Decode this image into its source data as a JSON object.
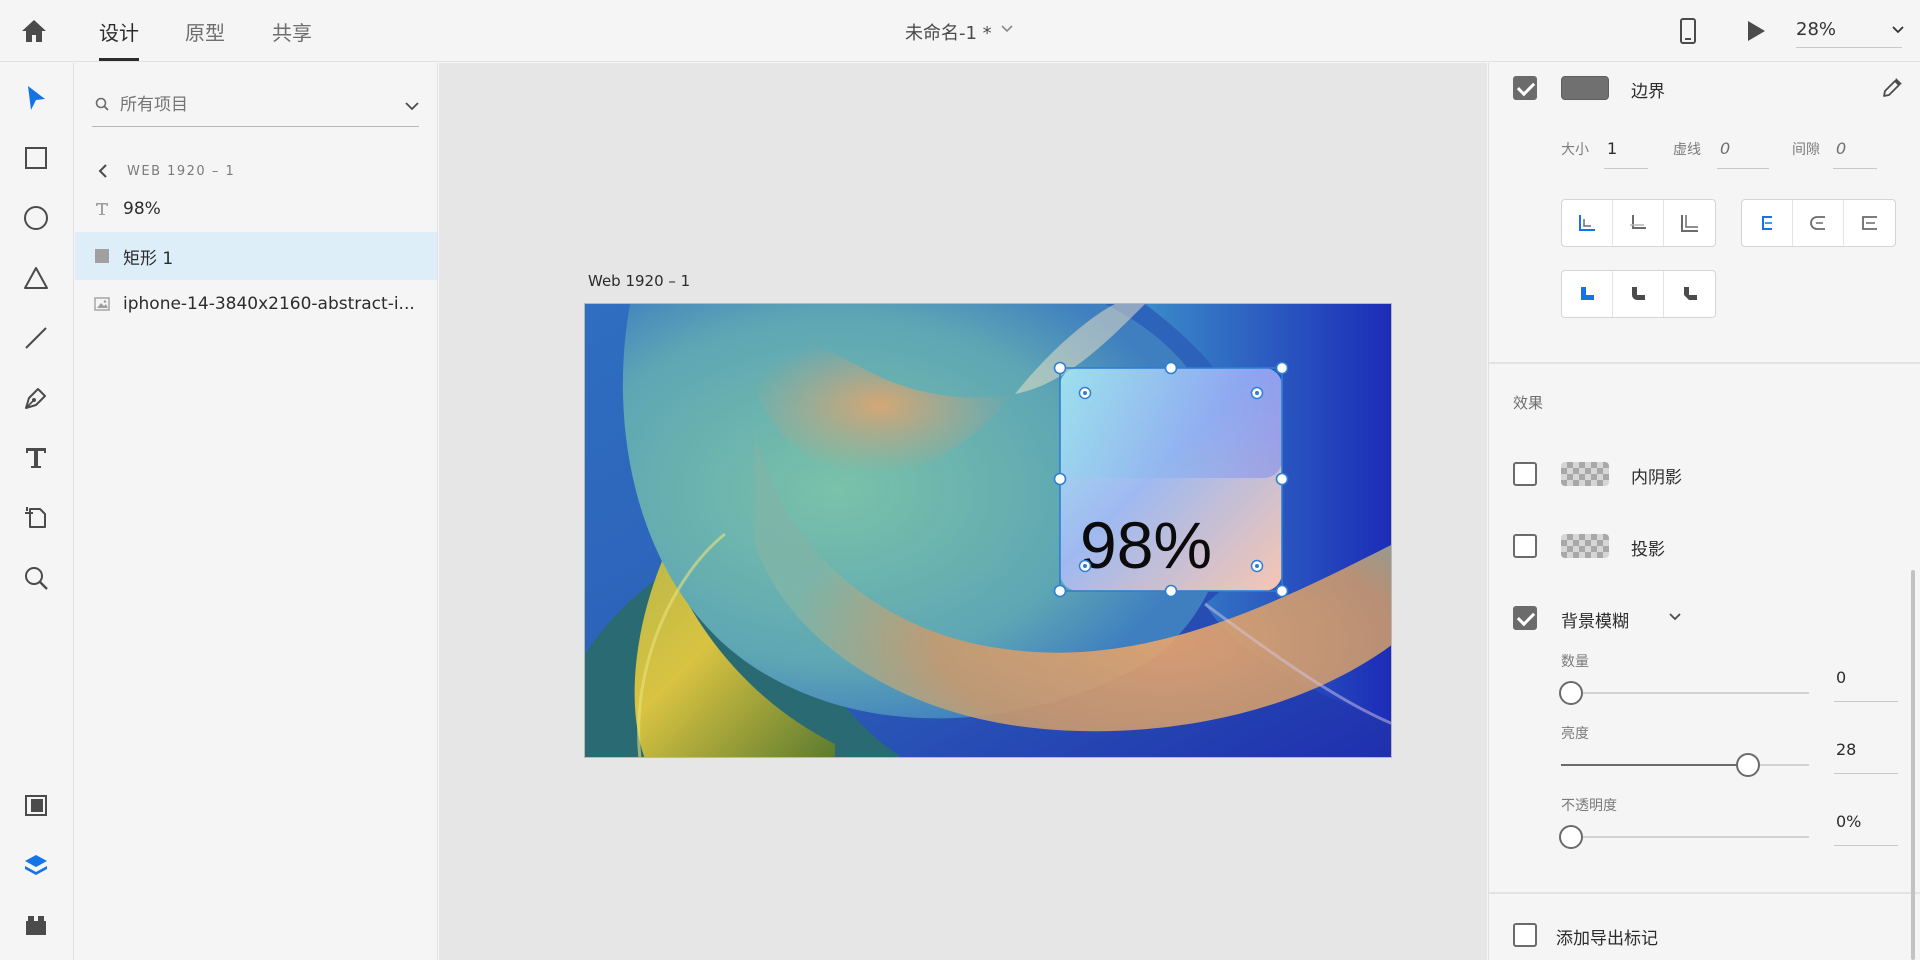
{
  "header": {
    "tabs": [
      {
        "label": "设计"
      },
      {
        "label": "原型"
      },
      {
        "label": "共享"
      }
    ],
    "document_title": "未命名-1 *",
    "zoom": "28%"
  },
  "toolbar": {
    "tools": [
      "select",
      "rectangle",
      "ellipse",
      "polygon",
      "line",
      "pen",
      "text",
      "artboard",
      "zoom"
    ],
    "bottom": [
      "assets",
      "layers",
      "plugins"
    ]
  },
  "layers": {
    "search_placeholder": "所有项目",
    "breadcrumb": "WEB 1920 – 1",
    "items": [
      {
        "name": "98%",
        "icon": "text-layer-icon",
        "selected": false
      },
      {
        "name": "矩形 1",
        "icon": "rectangle-layer-icon",
        "selected": true
      },
      {
        "name": "iphone-14-3840x2160-abstract-i...",
        "icon": "image-layer-icon",
        "selected": false
      }
    ]
  },
  "canvas": {
    "artboard_name": "Web 1920 – 1",
    "card_text": "98%"
  },
  "properties": {
    "border": {
      "label": "边界",
      "checked": true,
      "color": "#707070",
      "size_label": "大小",
      "size_value": "1",
      "dash_label": "虚线",
      "dash_value": "0",
      "gap_label": "间隙",
      "gap_value": "0"
    },
    "effects_title": "效果",
    "inner_shadow": {
      "label": "内阴影",
      "checked": false
    },
    "drop_shadow": {
      "label": "投影",
      "checked": false
    },
    "background_blur": {
      "label": "背景模糊",
      "checked": true,
      "amount_label": "数量",
      "amount_value": "0",
      "amount_fraction": 0,
      "brightness_label": "亮度",
      "brightness_value": "28",
      "brightness_fraction": 0.75,
      "opacity_label": "不透明度",
      "opacity_value": "0%",
      "opacity_fraction": 0
    },
    "export_mark": {
      "label": "添加导出标记",
      "checked": false
    }
  },
  "colors": {
    "accent": "#1473e6",
    "selection_blue": "#2d7fd3",
    "selected_row": "#deeef9"
  }
}
